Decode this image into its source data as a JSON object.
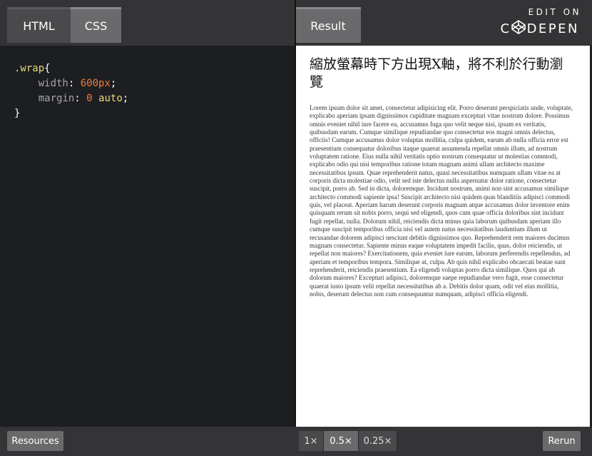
{
  "tabs": {
    "html": "HTML",
    "css": "CSS",
    "result": "Result"
  },
  "brand": {
    "edit": "EDIT ON",
    "name": "DEPEN"
  },
  "editor": {
    "selector": ".wrap",
    "open": "{",
    "close": "}",
    "declarations": [
      {
        "prop": "width",
        "value": "600px"
      },
      {
        "prop": "margin",
        "value_num": "0",
        "value_kw": "auto"
      }
    ]
  },
  "result": {
    "heading": "縮放螢幕時下方出現X軸，將不利於行動瀏覽",
    "body": "Lorem ipsum dolor sit amet, consectetur adipisicing elit. Porro deserunt perspiciatis unde, voluptate, explicabo aperiam ipsam dignissimos cupiditate magnam excepturi vitae nostrum dolore. Possimus omnis eveniet nihil iure facere ea, accusamus fuga quo velit neque nisi, ipsam ex veritatis, quibusdam earum. Cumque similique repudiandae quo consectetur eos magni omnis delectus, officiis! Cumque accusamus dolor voluptas mollitia, culpa quidem, earum ab nulla officia error est praesentium consequatur doloribus itaque quaerat assumenda repellat omnis illum, ad nostrum voluptatem ratione. Eius nulla nihil veritatis optio nostrum consequatur ut molestias commodi, explicabo odio qui nisi temporibus ratione totam magnam animi ullam architecto maxime necessitatibus ipsum. Quae reprehenderit natus, quasi necessitatibus numquam ullam vitae ea at corporis dicta molestiae odio, velit sed iste delectus nulla aspernatur dolor ratione, consectetur suscipit, porro ab. Sed in dicta, doloremque. Incidunt nostrum, animi non sint accusamus similique architecto commodi sapiente ipsa! Suscipit architecto nisi quidem quas blanditiis adipisci commodi quis, vel placeat. Aperiam harum deserunt corporis magnam atque accusamus dolor inventore enim quisquam rerum sit nobis porro, sequi sed eligendi, quos cum quae officia doloribus sint incidunt fugit repellat, nulla. Dolorum nihil, reiciendis dicta minus quia laborum quibusdam aperiam illo cumque suscipit temporibus officia nisi vel autem natus necessitatibus laudantium illum ut recusandae dolorem adipisci nesciunt debitis dignissimos quo. Reprehenderit rem maiores ducimus magnam consectetur. Sapiente minus eaque voluptatem impedit facilis, quas, dolor reiciendis, ut repellat non maiores? Exercitationem, quia eveniet iure earum, laborum perferendis repellendus, ad aperiam et temporibus tempora. Similique at, culpa. Ab quis nihil explicabo obcaecati beatae sunt reprehenderit, reiciendis praesentium. Ea eligendi voluptas porro dicta similique. Quos qui ab dolorum maiores? Excepturi adipisci, doloremque saepe repudiandae vero fugit, esse consectetur quaerat iusto ipsum velit repellat necessitatibus ab a. Debitis dolor quam, odit vel eius mollitia, nobis, deserunt delectus non cum consequuntur numquam, adipisci officia eligendi."
  },
  "bottom": {
    "resources": "Resources",
    "rerun": "Rerun",
    "zoom": [
      "1×",
      "0.5×",
      "0.25×"
    ],
    "zoom_active": "0.5×"
  }
}
